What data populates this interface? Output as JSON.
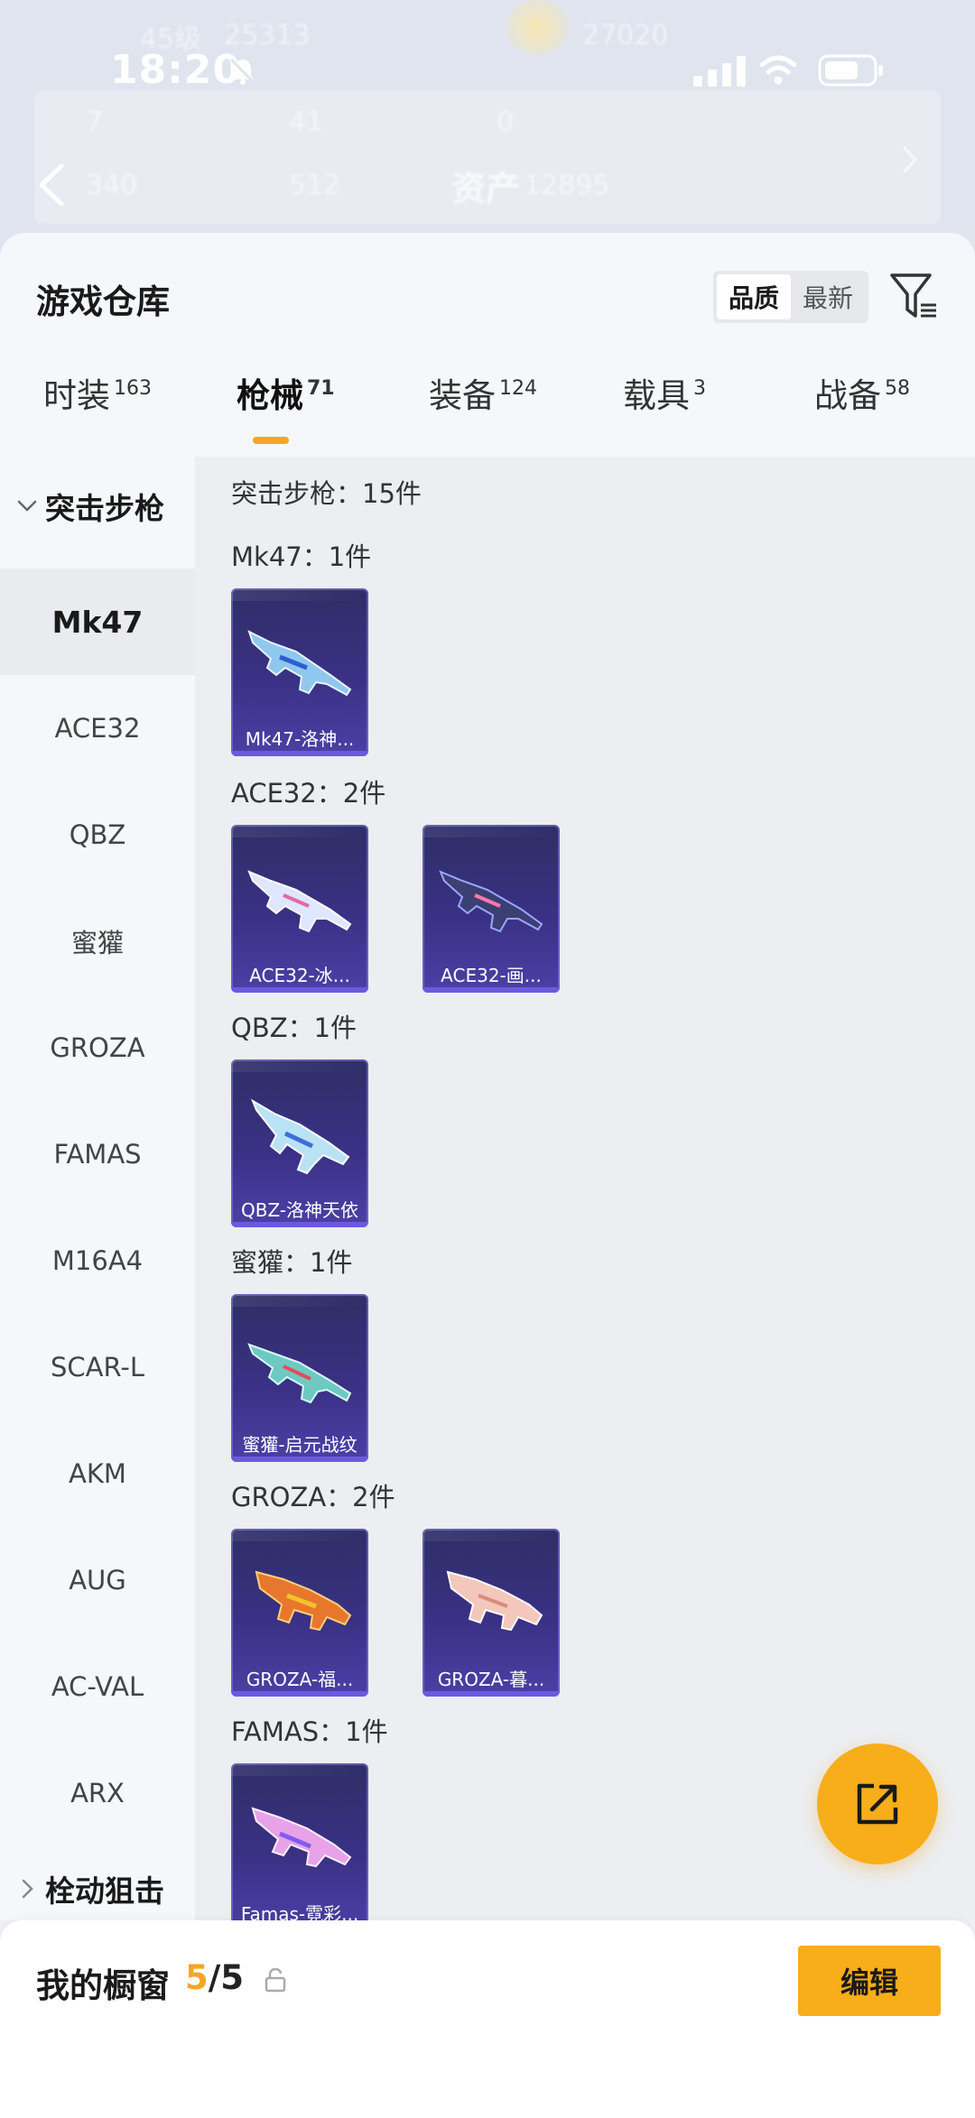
{
  "background_header": {
    "ghost_level": "45级",
    "ghost_coins": "25313",
    "ghost_score": "27020",
    "stats": [
      "7",
      "41",
      "0",
      "340",
      "512"
    ],
    "asset_label": "资产",
    "asset_value": "12895"
  },
  "status_bar": {
    "time": "18:20"
  },
  "sheet": {
    "title": "游戏仓库",
    "sort_options": [
      "品质",
      "最新"
    ],
    "active_sort": "品质"
  },
  "tabs": [
    {
      "label": "时装",
      "count": "163"
    },
    {
      "label": "枪械",
      "count": "71"
    },
    {
      "label": "装备",
      "count": "124"
    },
    {
      "label": "载具",
      "count": "3"
    },
    {
      "label": "战备",
      "count": "58"
    }
  ],
  "active_tab": "枪械",
  "sidenav": {
    "group_open": "突击步枪",
    "items": [
      "Mk47",
      "ACE32",
      "QBZ",
      "蜜獾",
      "GROZA",
      "FAMAS",
      "M16A4",
      "SCAR-L",
      "AKM",
      "AUG",
      "AC-VAL",
      "ARX"
    ],
    "active_item": "Mk47",
    "group_closed": "栓动狙击"
  },
  "content": {
    "summary": "突击步枪：15件",
    "sections": [
      {
        "header": "Mk47：1件",
        "cards": [
          "Mk47-洛神..."
        ]
      },
      {
        "header": "ACE32：2件",
        "cards": [
          "ACE32-冰...",
          "ACE32-画..."
        ]
      },
      {
        "header": "QBZ：1件",
        "cards": [
          "QBZ-洛神天依"
        ]
      },
      {
        "header": "蜜獾：1件",
        "cards": [
          "蜜獾-启元战纹"
        ]
      },
      {
        "header": "GROZA：2件",
        "cards": [
          "GROZA-福...",
          "GROZA-暮..."
        ]
      },
      {
        "header": "FAMAS：1件",
        "cards": [
          "Famas-霓彩..."
        ]
      }
    ]
  },
  "bottom_bar": {
    "title": "我的橱窗",
    "count_current": "5",
    "count_sep_total": "/5",
    "edit_label": "编辑"
  },
  "colors": {
    "accent": "#f8ad1a",
    "card_bg": "#3a3185",
    "active_underline": "#f5a623"
  },
  "icons": [
    "back-arrow-icon",
    "filter-icon",
    "share-icon",
    "lock-icon",
    "chevron-down-icon",
    "chevron-right-icon"
  ]
}
